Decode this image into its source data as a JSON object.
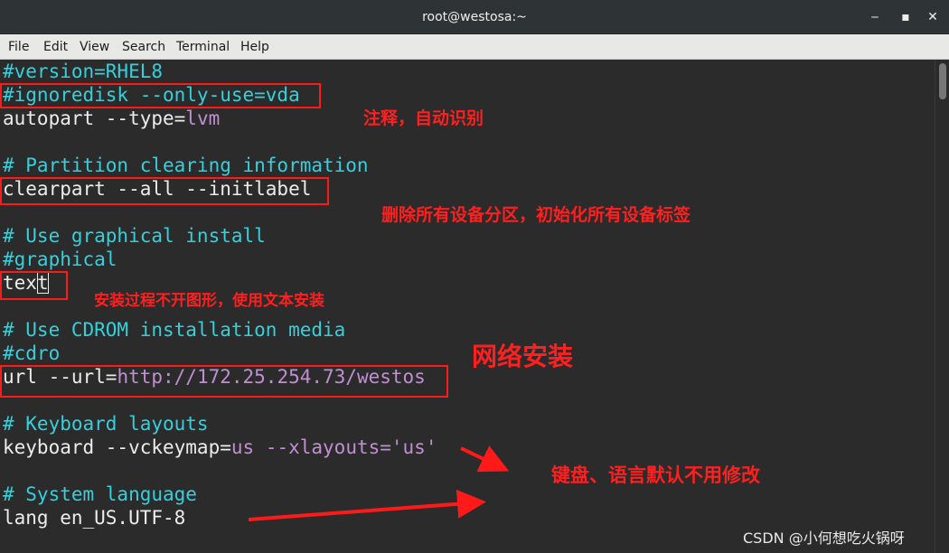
{
  "window": {
    "title": "root@westosa:~",
    "minimize_glyph": "‒",
    "maximize_glyph": "▪",
    "close_glyph": "✕"
  },
  "menu": [
    "File",
    "Edit",
    "View",
    "Search",
    "Terminal",
    "Help"
  ],
  "terminal": {
    "lines": [
      [
        {
          "t": "#version=RHEL8",
          "c": "c"
        }
      ],
      [
        {
          "t": "#ignoredisk --only-use=vda",
          "c": "c"
        }
      ],
      [
        {
          "t": "autopart --type=",
          "c": "w"
        },
        {
          "t": "lvm",
          "c": "m"
        }
      ],
      [],
      [
        {
          "t": "# Partition clearing information",
          "c": "c"
        }
      ],
      [
        {
          "t": "clearpart --all --initlabel",
          "c": "w"
        }
      ],
      [],
      [
        {
          "t": "# Use graphical install",
          "c": "c"
        }
      ],
      [
        {
          "t": "#graphical",
          "c": "c"
        }
      ],
      [
        {
          "t": "tex",
          "c": "w"
        },
        {
          "t": "t",
          "c": "cursor"
        }
      ],
      [],
      [
        {
          "t": "# Use CDROM installation media",
          "c": "c"
        }
      ],
      [
        {
          "t": "#cdro",
          "c": "c"
        }
      ],
      [
        {
          "t": "url --url=",
          "c": "w"
        },
        {
          "t": "http://172.25.254.73/westos",
          "c": "m"
        }
      ],
      [],
      [
        {
          "t": "# Keyboard layouts",
          "c": "c"
        }
      ],
      [
        {
          "t": "keyboard --vckeymap=",
          "c": "w"
        },
        {
          "t": "us",
          "c": "m"
        },
        {
          "t": " --xlayouts=",
          "c": "m"
        },
        {
          "t": "'us'",
          "c": "m"
        }
      ],
      [],
      [
        {
          "t": "# System language",
          "c": "c"
        }
      ],
      [
        {
          "t": "lang en_US.UTF-8",
          "c": "w"
        }
      ]
    ]
  },
  "annotations": {
    "note_comment": "注释，自动识别",
    "note_clearpart": "删除所有设备分区，初始化所有设备标签",
    "note_text": "安装过程不开图形，使用文本安装",
    "note_network": "网络安装",
    "note_keyboard": "键盘、语言默认不用修改",
    "annotation_color": "#ff1a1a"
  },
  "colors": {
    "comment": "#34d0dc",
    "value": "#c28ed3",
    "text": "#ececec",
    "background": "#2b2b2b"
  },
  "watermark": "CSDN @小何想吃火锅呀"
}
